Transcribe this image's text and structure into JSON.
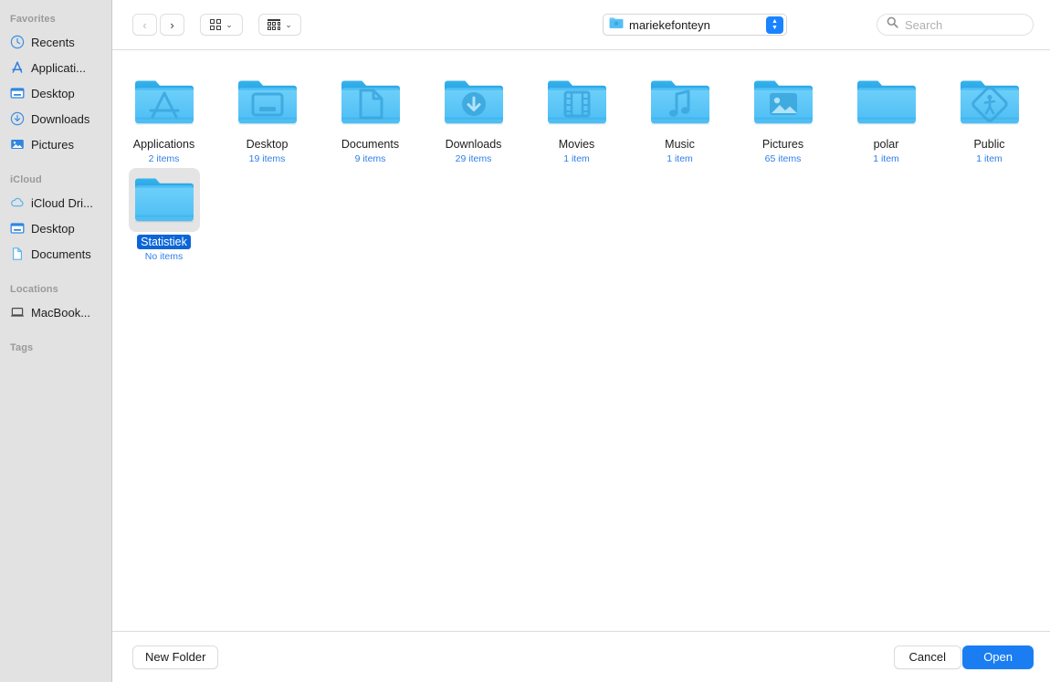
{
  "sidebar": {
    "sections": [
      {
        "header": "Favorites",
        "items": [
          {
            "label": "Recents",
            "icon": "clock-icon"
          },
          {
            "label": "Applicati...",
            "icon": "app-store-icon"
          },
          {
            "label": "Desktop",
            "icon": "desktop-icon"
          },
          {
            "label": "Downloads",
            "icon": "download-icon"
          },
          {
            "label": "Pictures",
            "icon": "photo-icon"
          }
        ]
      },
      {
        "header": "iCloud",
        "items": [
          {
            "label": "iCloud Dri...",
            "icon": "cloud-icon"
          },
          {
            "label": "Desktop",
            "icon": "desktop-icon"
          },
          {
            "label": "Documents",
            "icon": "document-icon"
          }
        ]
      },
      {
        "header": "Locations",
        "items": [
          {
            "label": "MacBook...",
            "icon": "laptop-icon"
          }
        ]
      },
      {
        "header": "Tags",
        "items": []
      }
    ]
  },
  "toolbar": {
    "back_label": "‹",
    "forward_label": "›",
    "back_enabled": false,
    "forward_enabled": true,
    "icon_view_caret": "⌄",
    "gallery_view_caret": "⌄",
    "path": {
      "label": "mariekefonteyn",
      "icon": "home-folder-icon"
    },
    "search": {
      "placeholder": "Search",
      "value": "",
      "icon": "search-icon"
    }
  },
  "files": [
    {
      "name": "Applications",
      "count": "2 items",
      "glyph": "app-store",
      "selected": false
    },
    {
      "name": "Desktop",
      "count": "19 items",
      "glyph": "desktop",
      "selected": false
    },
    {
      "name": "Documents",
      "count": "9 items",
      "glyph": "document",
      "selected": false
    },
    {
      "name": "Downloads",
      "count": "29 items",
      "glyph": "download",
      "selected": false
    },
    {
      "name": "Movies",
      "count": "1 item",
      "glyph": "film",
      "selected": false
    },
    {
      "name": "Music",
      "count": "1 item",
      "glyph": "music",
      "selected": false
    },
    {
      "name": "Pictures",
      "count": "65 items",
      "glyph": "photo",
      "selected": false
    },
    {
      "name": "polar",
      "count": "1 item",
      "glyph": "none",
      "selected": false
    },
    {
      "name": "Public",
      "count": "1 item",
      "glyph": "public",
      "selected": false
    },
    {
      "name": "Statistiek",
      "count": "No items",
      "glyph": "none",
      "selected": true
    }
  ],
  "footer": {
    "new_folder_label": "New Folder",
    "cancel_label": "Cancel",
    "open_label": "Open"
  },
  "colors": {
    "accent": "#1a7ef2",
    "selection": "#0a65d8",
    "count_text": "#2f7fe8",
    "folder_blue": "#54c4f5",
    "sidebar_bg": "#e2e2e2"
  }
}
